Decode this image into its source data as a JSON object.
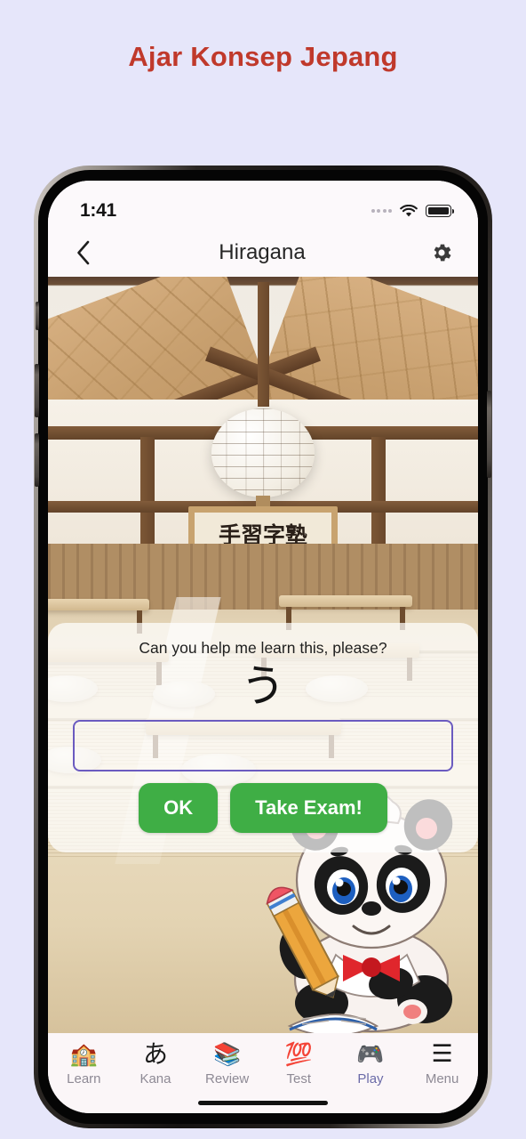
{
  "page": {
    "title": "Ajar Konsep Jepang",
    "title_color": "#C0392B",
    "background_color": "#E6E6FA"
  },
  "status_bar": {
    "time": "1:41",
    "signal_icon": "signal-dots-icon",
    "wifi_icon": "wifi-icon",
    "battery_icon": "battery-full-icon"
  },
  "nav_bar": {
    "back_icon": "chevron-left-icon",
    "title": "Hiragana",
    "settings_icon": "gear-icon"
  },
  "scene": {
    "plaque_text": "手習字塾",
    "description": "traditional japanese classroom"
  },
  "dialog": {
    "prompt": "Can you help me learn this, please?",
    "character": "う",
    "input_value": "",
    "input_placeholder": "",
    "input_border_color": "#6B5BC0",
    "buttons": [
      {
        "label": "OK",
        "name": "ok-button",
        "color": "#3FAE45"
      },
      {
        "label": "Take Exam!",
        "name": "take-exam-button",
        "color": "#3FAE45"
      }
    ]
  },
  "mascot": {
    "name": "panda-mascot",
    "description": "panda with pencil and book"
  },
  "tab_bar": {
    "active_color": "#6B6BA8",
    "inactive_color": "#8E8A95",
    "items": [
      {
        "label": "Learn",
        "icon": "school-icon",
        "glyph": "🏫",
        "active": false
      },
      {
        "label": "Kana",
        "icon": "hiragana-a-icon",
        "glyph": "あ",
        "active": false
      },
      {
        "label": "Review",
        "icon": "books-icon",
        "glyph": "📚",
        "active": false
      },
      {
        "label": "Test",
        "icon": "hundred-points-icon",
        "glyph": "💯",
        "active": false
      },
      {
        "label": "Play",
        "icon": "game-controller-icon",
        "glyph": "🎮",
        "active": true
      },
      {
        "label": "Menu",
        "icon": "hamburger-menu-icon",
        "glyph": "☰",
        "active": false
      }
    ]
  }
}
